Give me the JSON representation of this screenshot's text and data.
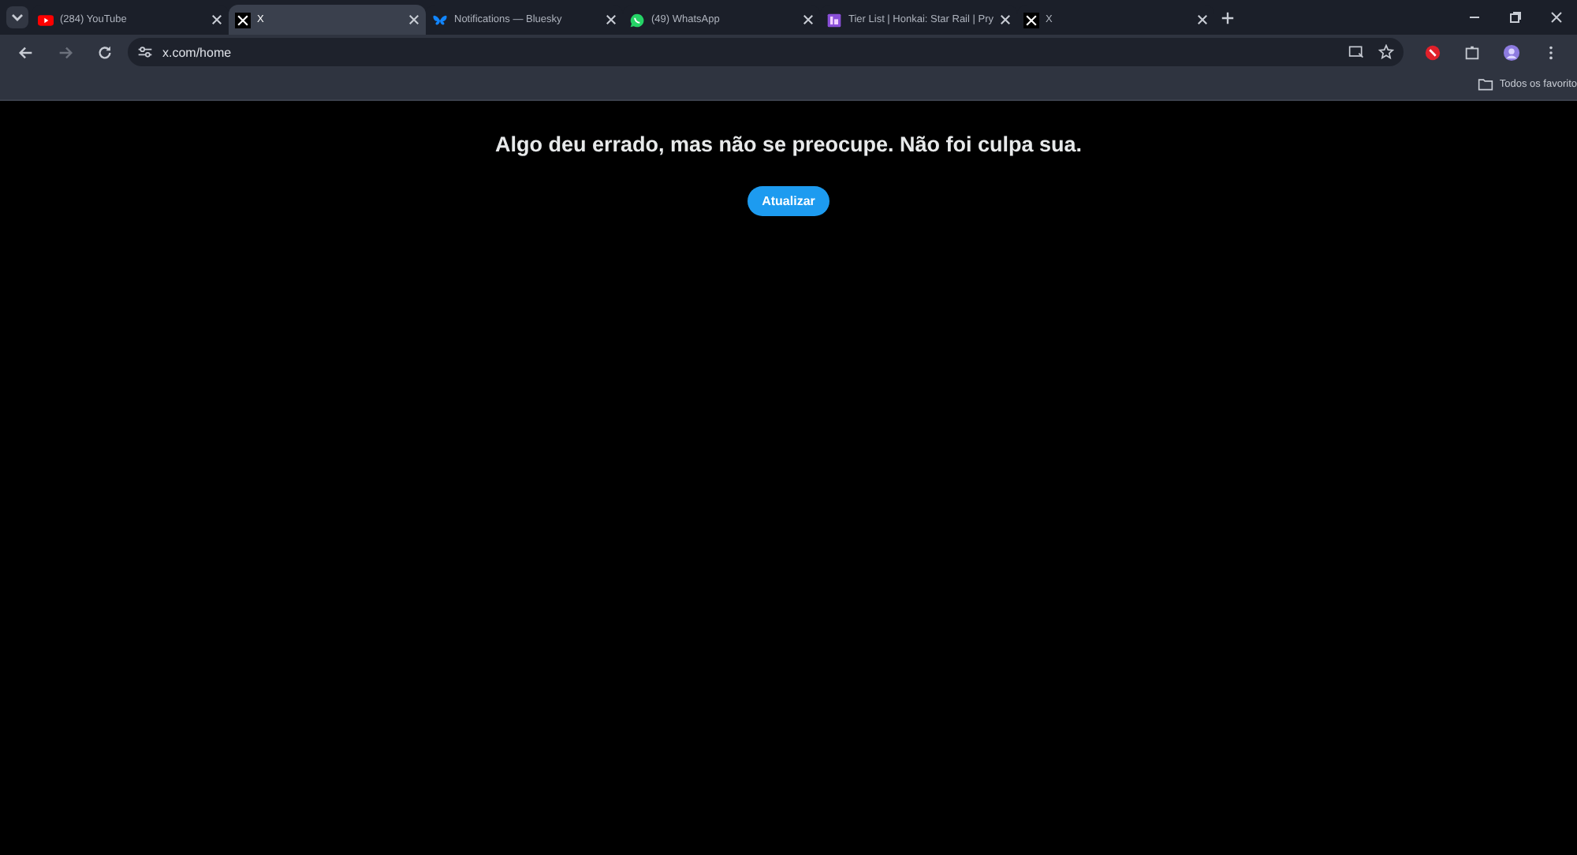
{
  "tabs": [
    {
      "label": "(284) YouTube",
      "kind": "video",
      "selected": false
    },
    {
      "label": "X",
      "kind": "x",
      "selected": true
    },
    {
      "label": "Notifications — Bluesky",
      "kind": "butterfly",
      "selected": false
    },
    {
      "label": "(49) WhatsApp",
      "kind": "chat",
      "selected": false
    },
    {
      "label": "Tier List | Honkai: Star Rail | Pry",
      "kind": "tier",
      "selected": false
    },
    {
      "label": "X",
      "kind": "x",
      "selected": false
    }
  ],
  "address": "x.com/home",
  "bookmarks": [
    {
      "label": "Todos os favorito"
    }
  ],
  "error": {
    "message": "Algo deu errado, mas não se preocupe. Não foi culpa sua.",
    "button": "Atualizar"
  }
}
